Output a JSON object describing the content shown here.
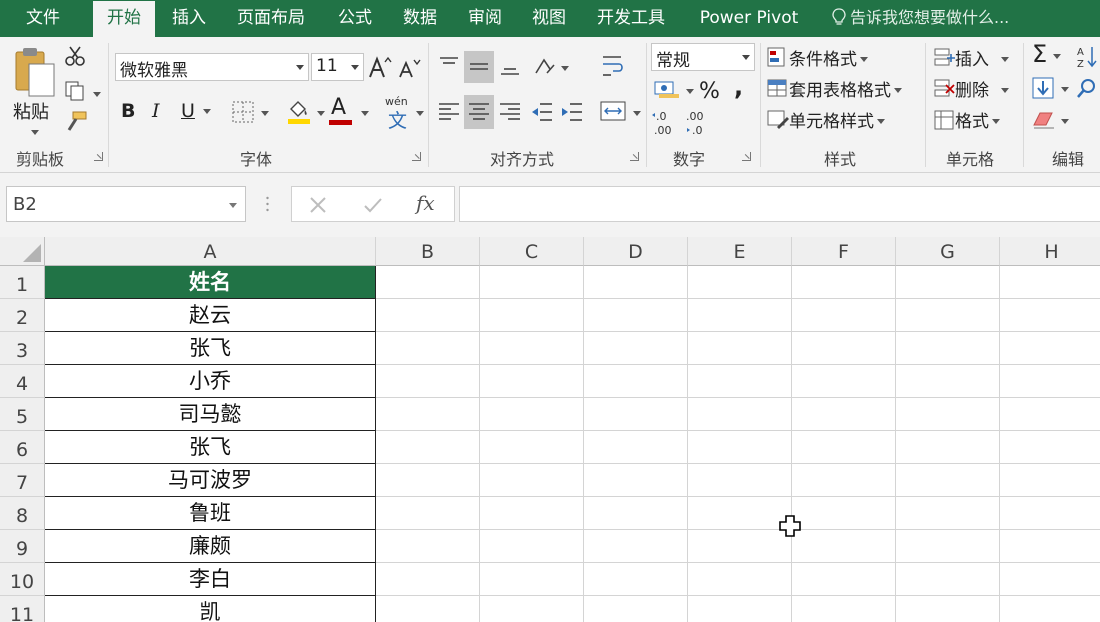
{
  "tabs": [
    {
      "label": "文件",
      "active": false
    },
    {
      "label": "开始",
      "active": true
    },
    {
      "label": "插入",
      "active": false
    },
    {
      "label": "页面布局",
      "active": false
    },
    {
      "label": "公式",
      "active": false
    },
    {
      "label": "数据",
      "active": false
    },
    {
      "label": "审阅",
      "active": false
    },
    {
      "label": "视图",
      "active": false
    },
    {
      "label": "开发工具",
      "active": false
    },
    {
      "label": "Power Pivot",
      "active": false
    }
  ],
  "tell_me": "告诉我您想要做什么...",
  "ribbon": {
    "clipboard": {
      "label": "剪贴板",
      "paste_label": "粘贴"
    },
    "font": {
      "label": "字体",
      "font_name": "微软雅黑",
      "font_size": "11",
      "wen_label": "wén",
      "wen_char": "文"
    },
    "alignment": {
      "label": "对齐方式"
    },
    "number": {
      "label": "数字",
      "format": "常规",
      "percent": "%",
      "comma": ","
    },
    "styles": {
      "label": "样式",
      "conditional": "条件格式",
      "table_format": "套用表格格式",
      "cell_style": "单元格样式"
    },
    "cells": {
      "label": "单元格",
      "insert": "插入",
      "delete": "删除",
      "format": "格式"
    },
    "editing": {
      "label": "编辑"
    }
  },
  "formula_bar": {
    "name_box": "B2",
    "fx": "fx",
    "value": ""
  },
  "colors": {
    "accent": "#217346",
    "font_highlight": "#ffd700",
    "font_color": "#c00000"
  },
  "grid": {
    "columns": [
      "A",
      "B",
      "C",
      "D",
      "E",
      "F",
      "G",
      "H"
    ],
    "rows": [
      "1",
      "2",
      "3",
      "4",
      "5",
      "6",
      "7",
      "8",
      "9",
      "10",
      "11"
    ],
    "column_a": [
      "姓名",
      "赵云",
      "张飞",
      "小乔",
      "司马懿",
      "张飞",
      "马可波罗",
      "鲁班",
      "廉颇",
      "李白",
      "凯"
    ]
  }
}
